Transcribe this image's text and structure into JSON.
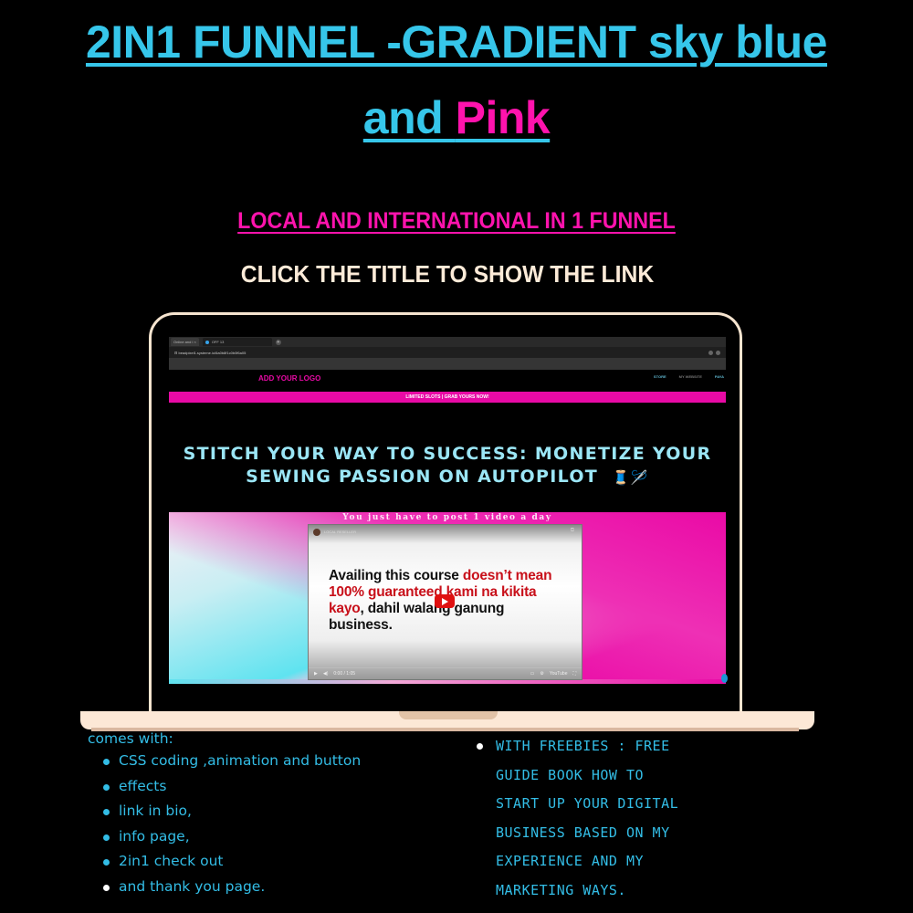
{
  "title": {
    "line1": "2IN1 FUNNEL -GRADIENT sky blue",
    "line2_part1": "and ",
    "line2_part2": "Pink"
  },
  "subtitle": "LOCAL AND INTERNATIONAL IN 1 FUNNEL",
  "cta": "CLICK THE TITLE TO SHOW THE LINK",
  "colors": {
    "sky_blue": "#36c6ea",
    "pink": "#ff13ad",
    "cream": "#fdebd8",
    "background": "#000000"
  },
  "laptop_screen": {
    "browser": {
      "tabs": [
        {
          "label": "Online and i",
          "active": false
        },
        {
          "label": "OFF 13",
          "active": true
        }
      ],
      "address": "beadpixel1.systeme.io/6a0b8f1c0b0f6a05"
    },
    "site": {
      "logo": "ADD YOUR LOGO",
      "nav": [
        "STORE",
        "MY WEBSITE",
        "PAYA"
      ],
      "promo_bar": "LIMITED SLOTS | GRAB YOURS NOW!",
      "headline_line1": "STITCH YOUR WAY TO SUCCESS: MONETIZE YOUR",
      "headline_line2": "SEWING PASSION ON AUTOPILOT",
      "headline_emoji": "🧵🪡",
      "hero_caption": "You just have to post 1 video a day",
      "video": {
        "channel": "LOCAL RESELLER",
        "text_black_1": "Availing this course ",
        "text_red_1": "doesn’t mean 100% guaranteed kami na kikita kayo",
        "text_black_2": ", dahil walang ganung business.",
        "time": "0:00 / 1:05",
        "brand": "YouTube"
      }
    }
  },
  "features": {
    "lead": "comes with:",
    "items": [
      "CSS coding ,animation and button",
      "effects",
      "link in bio,",
      "info page,",
      "2in1 check out",
      "and thank you page."
    ]
  },
  "freebies": {
    "lines": [
      "WITH FREEBIES :  FREE",
      "GUIDE  BOOK HOW TO",
      "START UP YOUR DIGITAL",
      "BUSINESS BASED ON MY",
      "EXPERIENCE AND MY",
      "MARKETING WAYS."
    ]
  }
}
